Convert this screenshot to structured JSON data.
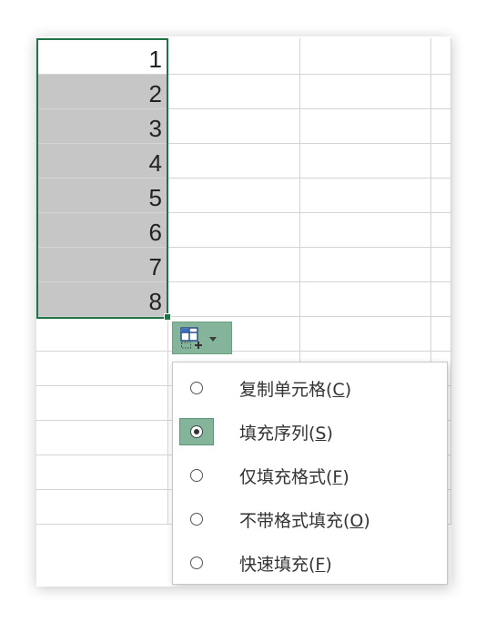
{
  "cells": {
    "a": [
      "1",
      "2",
      "3",
      "4",
      "5",
      "6",
      "7",
      "8"
    ]
  },
  "autofill_button": {
    "icon": "autofill-options-icon",
    "dropdown_icon": "dropdown-arrow-icon"
  },
  "menu": {
    "items": [
      {
        "label_pre": "复制单元格(",
        "accel": "C",
        "label_post": ")",
        "checked": false
      },
      {
        "label_pre": "填充序列(",
        "accel": "S",
        "label_post": ")",
        "checked": true
      },
      {
        "label_pre": "仅填充格式(",
        "accel": "F",
        "label_post": ")",
        "checked": false
      },
      {
        "label_pre": "不带格式填充(",
        "accel": "O",
        "label_post": ")",
        "checked": false
      },
      {
        "label_pre": "快速填充(",
        "accel": "F",
        "label_post": ")",
        "checked": false
      }
    ]
  },
  "colors": {
    "selection_border": "#217346",
    "selection_fill": "#c6c6c6",
    "highlight": "#84b59a"
  }
}
